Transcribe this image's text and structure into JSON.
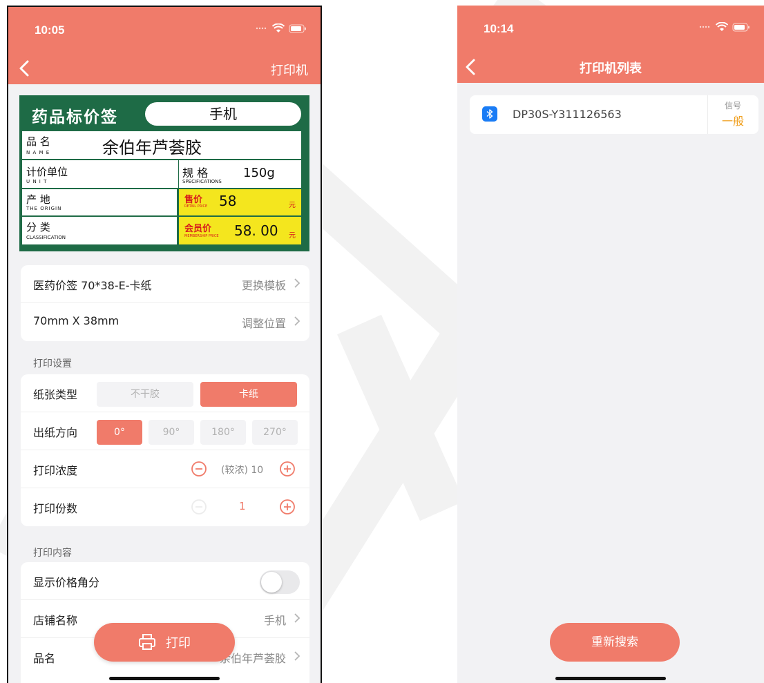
{
  "left": {
    "status_time": "10:05",
    "nav_action": "打印机",
    "label": {
      "title": "药品标价签",
      "store": "手机",
      "name_cn": "品 名",
      "name_en": "N A M E",
      "name_value": "余伯年芦荟胶",
      "unit_cn": "计价单位",
      "unit_en": "U N I T",
      "spec_cn": "规 格",
      "spec_en": "SPECIFICATIONS",
      "spec_value": "150g",
      "origin_cn": "产 地",
      "origin_en": "THE ORIGIN",
      "retail_cn": "售价",
      "retail_en": "RETAIL PRICE",
      "retail_value": "58",
      "yuan": "元",
      "class_cn": "分 类",
      "class_en": "CLASSIFICATION",
      "member_cn": "会员价",
      "member_en": "MEMBERSHIP PRICE",
      "member_value": "58. 00"
    },
    "template": {
      "name": "医药价签 70*38-E-卡纸",
      "change": "更换模板",
      "size": "70mm X 38mm",
      "adjust": "调整位置"
    },
    "settings_title": "打印设置",
    "paper_type": {
      "label": "纸张类型",
      "options": [
        "不干胶",
        "卡纸"
      ],
      "selected": "卡纸"
    },
    "direction": {
      "label": "出纸方向",
      "options": [
        "0°",
        "90°",
        "180°",
        "270°"
      ],
      "selected": "0°"
    },
    "density": {
      "label": "打印浓度",
      "value": "(较浓) 10"
    },
    "copies": {
      "label": "打印份数",
      "value": "1"
    },
    "content_title": "打印内容",
    "show_cents": {
      "label": "显示价格角分",
      "on": false
    },
    "store_name": {
      "label": "店铺名称",
      "value": "手机"
    },
    "product_name": {
      "label": "品名",
      "value": "余伯年芦荟胶"
    },
    "print_button": "打印"
  },
  "right": {
    "status_time": "10:14",
    "title": "打印机列表",
    "device": {
      "name": "DP30S-Y311126563",
      "signal_label": "信号",
      "signal_value": "一般"
    },
    "research_button": "重新搜索"
  },
  "colors": {
    "accent": "#f07b6a",
    "label_green": "#1e6b46",
    "label_yellow": "#f4e61e",
    "signal": "#f0a020",
    "bluetooth": "#1a7cf5"
  }
}
